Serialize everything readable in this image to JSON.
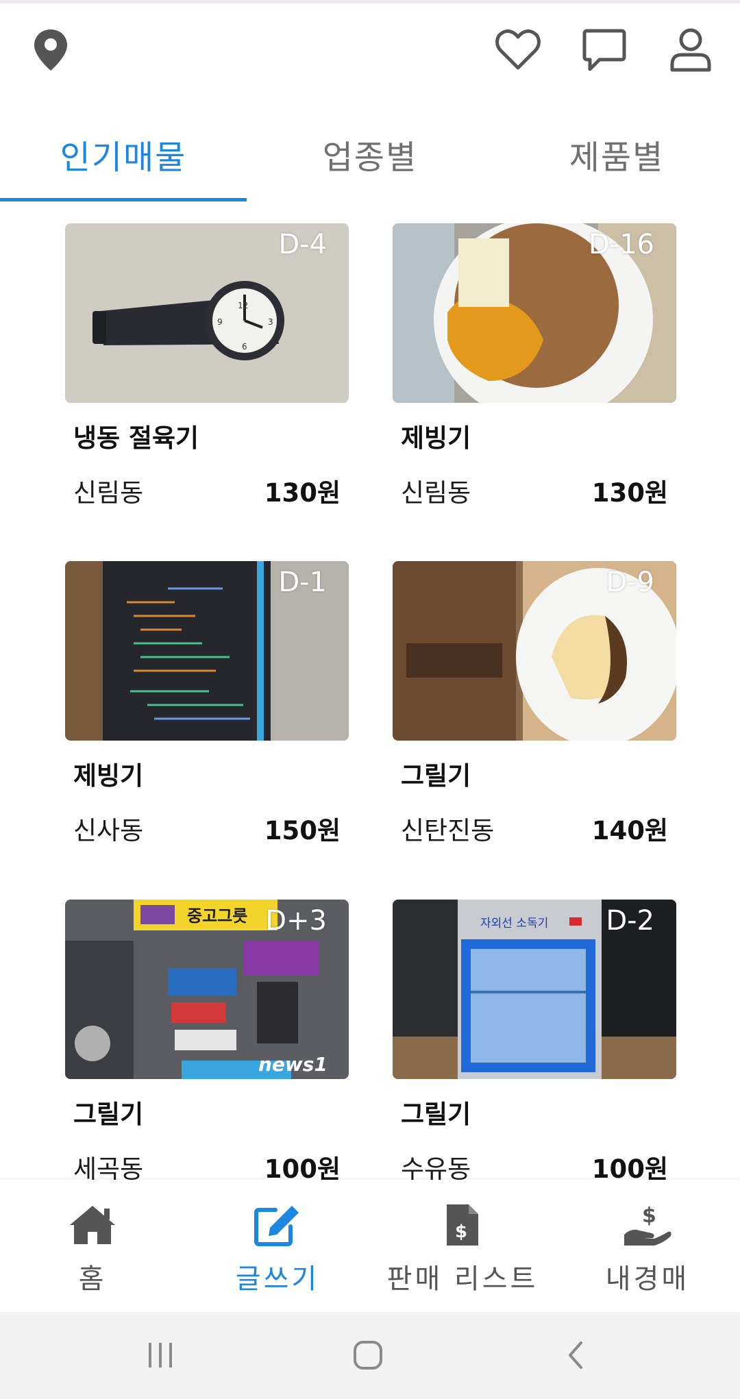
{
  "top_bar": {
    "icons": [
      "location-pin-icon",
      "heart-icon",
      "chat-icon",
      "user-icon"
    ]
  },
  "tabs": [
    {
      "label": "인기매물",
      "active": true
    },
    {
      "label": "업종별",
      "active": false
    },
    {
      "label": "제품별",
      "active": false
    }
  ],
  "listings": [
    {
      "dday": "D-4",
      "title": "냉동 절육기",
      "location": "신림동",
      "price": "130원",
      "image": "wristwatch-photo"
    },
    {
      "dday": "D-16",
      "title": "제빙기",
      "location": "신림동",
      "price": "130원",
      "image": "pancake-plate-photo"
    },
    {
      "dday": "D-1",
      "title": "제빙기",
      "location": "신사동",
      "price": "150원",
      "image": "laptop-code-photo"
    },
    {
      "dday": "D-9",
      "title": "그릴기",
      "location": "신탄진동",
      "price": "140원",
      "image": "cake-plate-photo"
    },
    {
      "dday": "D+3",
      "title": "그릴기",
      "location": "세곡동",
      "price": "100원",
      "image": "used-goods-store-photo",
      "sign_text": "중고그릇",
      "watermark": "news1"
    },
    {
      "dday": "D-2",
      "title": "그릴기",
      "location": "수유동",
      "price": "100원",
      "image": "uv-sterilizer-cabinet-photo",
      "cabinet_label": "자외선 소독기"
    }
  ],
  "bottom_nav": [
    {
      "label": "홈",
      "icon": "home-icon",
      "active": false
    },
    {
      "label": "글쓰기",
      "icon": "edit-icon",
      "active": true
    },
    {
      "label": "판매 리스트",
      "icon": "invoice-icon",
      "active": false
    },
    {
      "label": "내경매",
      "icon": "hand-dollar-icon",
      "active": false
    }
  ],
  "colors": {
    "accent": "#1c86e0",
    "text": "#111111",
    "muted": "#707070",
    "icon": "#555555"
  }
}
